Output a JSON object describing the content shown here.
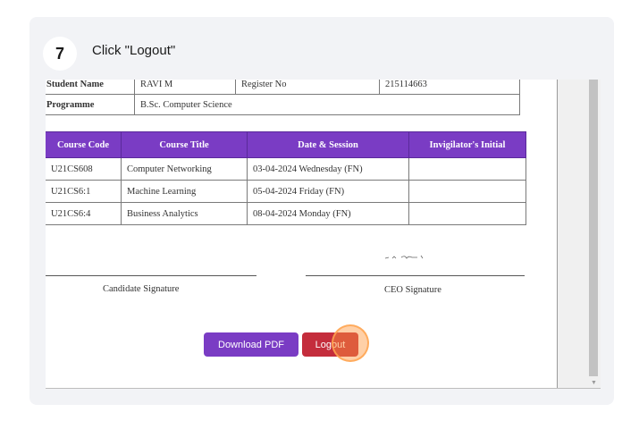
{
  "step": {
    "number": "7",
    "instruction": "Click \"Logout\""
  },
  "student_info": {
    "name_label": "Student Name",
    "name": "RAVI M",
    "register_label": "Register No",
    "register": "215114663",
    "programme_label": "Programme",
    "programme": "B.Sc. Computer Science"
  },
  "course_table": {
    "headers": [
      "Course Code",
      "Course Title",
      "Date & Session",
      "Invigilator's Initial"
    ],
    "rows": [
      [
        "U21CS608",
        "Computer Networking",
        "03-04-2024 Wednesday (FN)",
        ""
      ],
      [
        "U21CS6:1",
        "Machine Learning",
        "05-04-2024 Friday (FN)",
        ""
      ],
      [
        "U21CS6:4",
        "Business Analytics",
        "08-04-2024 Monday (FN)",
        ""
      ]
    ]
  },
  "signatures": {
    "candidate_label": "Candidate Signature",
    "ceo_label": "CEO Signature"
  },
  "buttons": {
    "download_pdf": "Download PDF",
    "logout": "Logout"
  },
  "colors": {
    "header_purple": "#7a3cc4",
    "logout_red": "#c42d3c",
    "click_highlight": "#ff9a3c"
  },
  "icons": {
    "ceo_signature": "handwritten-signature",
    "click_marker": "click-highlight"
  }
}
